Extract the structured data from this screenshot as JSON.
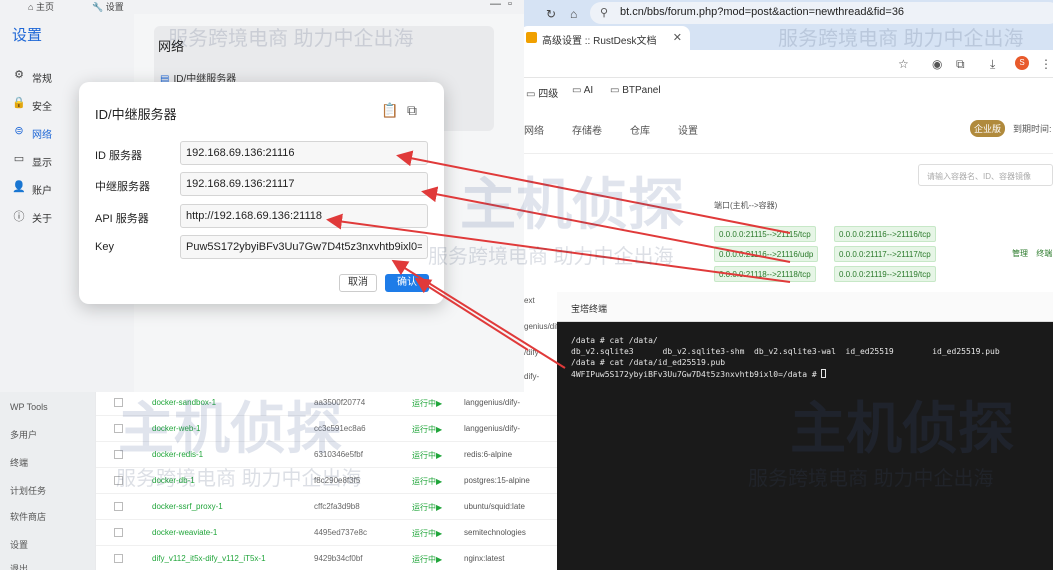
{
  "settings_window": {
    "top_tabs": [
      "主页",
      "设置"
    ],
    "title": "设置",
    "nav": [
      {
        "icon": "gear-icon",
        "glyph": "⚙",
        "label": "常规"
      },
      {
        "icon": "lock-icon",
        "glyph": "🔒",
        "label": "安全"
      },
      {
        "icon": "link-icon",
        "glyph": "⊜",
        "label": "网络",
        "active": true
      },
      {
        "icon": "monitor-icon",
        "glyph": "▭",
        "label": "显示"
      },
      {
        "icon": "user-icon",
        "glyph": "👤",
        "label": "账户"
      },
      {
        "icon": "info-icon",
        "glyph": "ⓘ",
        "label": "关于"
      }
    ],
    "section_title": "网络",
    "section_item": "ID/中继服务器"
  },
  "dialog": {
    "title": "ID/中继服务器",
    "fields": [
      {
        "label": "ID 服务器",
        "value": "192.168.69.136:21116"
      },
      {
        "label": "中继服务器",
        "value": "192.168.69.136:21117"
      },
      {
        "label": "API 服务器",
        "value": "http://192.168.69.136:21118"
      },
      {
        "label": "Key",
        "value": "Puw5S172ybyiBFv3Uu7Gw7D4t5z3nxvhtb9ixl0="
      }
    ],
    "cancel_label": "取消",
    "ok_label": "确认"
  },
  "browser": {
    "tab_title": "高级设置 :: RustDesk文档",
    "url": "bt.cn/bbs/forum.php?mod=post&action=newthread&fid=36",
    "bookmarks": [
      "四级",
      "AI",
      "BTPanel"
    ],
    "badge": "S"
  },
  "panel": {
    "tabs": [
      "网络",
      "存储卷",
      "仓库",
      "设置"
    ],
    "vip_label": "企业版",
    "expire_label": "到期时间:",
    "search_placeholder": "请输入容器名、ID、容器镜像",
    "port_column": "端口(主机-->容器)",
    "ports": [
      "0.0.0.0:21115-->21115/tcp",
      "0.0.0.0:21116-->21116/tcp",
      "0.0.0.0:21116-->21116/udp",
      "0.0.0.0:21117-->21117/tcp",
      "0.0.0.0:21118-->21118/tcp",
      "0.0.0.0:21119-->21119/tcp"
    ],
    "row_actions": [
      "管理",
      "终端"
    ],
    "partial_images": [
      "ext",
      "genius/dify-",
      "/dify-",
      "dify-"
    ],
    "left_menu": [
      "WP Tools",
      "多用户",
      "终端",
      "计划任务",
      "软件商店",
      "设置",
      "退出"
    ],
    "containers": [
      {
        "name": "docker-sandbox-1",
        "id": "aa3500f20774",
        "status": "运行中▶",
        "image": "langgenius/dify-"
      },
      {
        "name": "docker-web-1",
        "id": "cc3c591ec8a6",
        "status": "运行中▶",
        "image": "langgenius/dify-"
      },
      {
        "name": "docker-redis-1",
        "id": "6310346e5fbf",
        "status": "运行中▶",
        "image": "redis:6-alpine"
      },
      {
        "name": "docker-db-1",
        "id": "f8c290e8f3f5",
        "status": "运行中▶",
        "image": "postgres:15-alpine"
      },
      {
        "name": "docker-ssrf_proxy-1",
        "id": "cffc2fa3d9b8",
        "status": "运行中▶",
        "image": "ubuntu/squid:late"
      },
      {
        "name": "docker-weaviate-1",
        "id": "4495ed737e8c",
        "status": "运行中▶",
        "image": "semitechnologies"
      },
      {
        "name": "dify_v112_it5x-dify_v112_iT5x-1",
        "id": "9429b34cf0bf",
        "status": "运行中▶",
        "image": "nginx:latest"
      }
    ]
  },
  "terminal": {
    "title": "宝塔终端",
    "lines": [
      "/data # cat /data/",
      "db_v2.sqlite3      db_v2.sqlite3-shm  db_v2.sqlite3-wal  id_ed25519        id_ed25519.pub",
      "/data # cat /data/id_ed25519.pub",
      "4WFIPuw5S172ybyiBFv3Uu7Gw7D4t5z3nxvhtb9ixl0=/data # "
    ]
  },
  "watermark": {
    "slogan": "服务跨境电商 助力中企出海",
    "brand": "主机侦探"
  },
  "colors": {
    "accent": "#1e67d6",
    "ok_button": "#1e7ce8",
    "arrow": "#e03a3a",
    "status_green": "#20a53a"
  }
}
